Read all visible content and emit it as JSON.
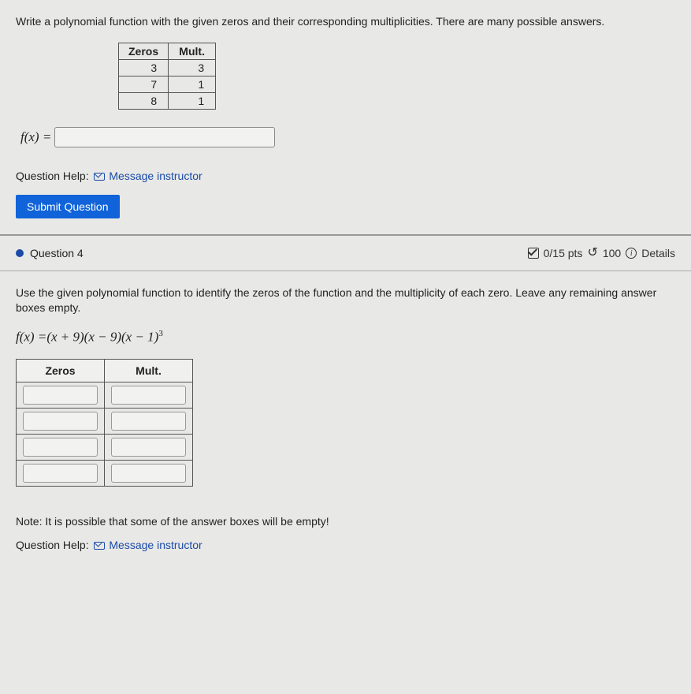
{
  "q3": {
    "prompt": "Write a polynomial function with the given zeros and their corresponding multiplicities. There are many possible answers.",
    "headers": {
      "zeros": "Zeros",
      "mult": "Mult."
    },
    "rows": [
      {
        "zero": "3",
        "mult": "3"
      },
      {
        "zero": "7",
        "mult": "1"
      },
      {
        "zero": "8",
        "mult": "1"
      }
    ],
    "fx_label": "f(x) =",
    "fx_value": "",
    "help_label": "Question Help:",
    "help_link": "Message instructor",
    "submit": "Submit Question"
  },
  "q4header": {
    "title": "Question 4",
    "pts": "0/15 pts",
    "retries": "100",
    "details": "Details"
  },
  "q4": {
    "prompt": "Use the given polynomial function to identify the zeros of the function and the multiplicity of each zero. Leave any remaining answer boxes empty.",
    "formula_prefix": "f(x) =",
    "formula_body": "(x + 9)(x − 9)(x − 1)",
    "formula_exp": "3",
    "headers": {
      "zeros": "Zeros",
      "mult": "Mult."
    },
    "note": "Note: It is possible that some of the answer boxes will be empty!",
    "help_label": "Question Help:",
    "help_link": "Message instructor"
  }
}
